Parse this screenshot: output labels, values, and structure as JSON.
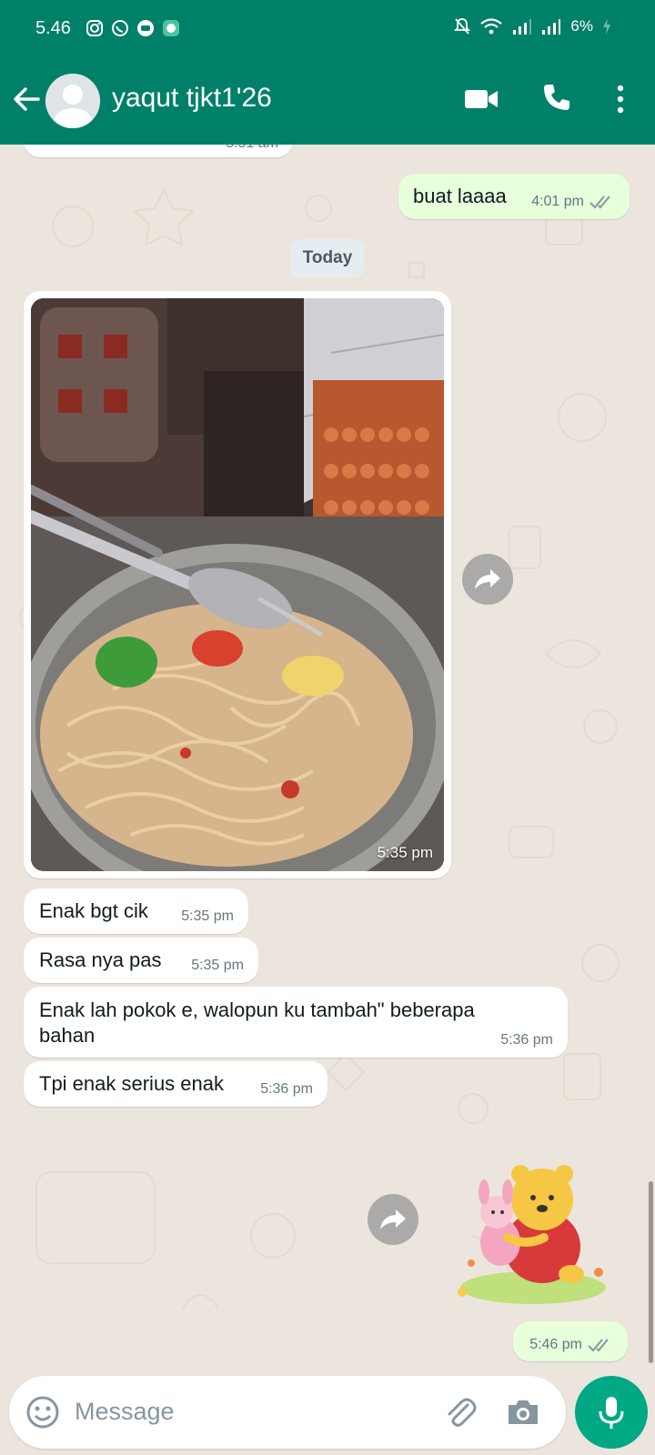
{
  "status_bar": {
    "time": "5.46",
    "battery": "6%"
  },
  "header": {
    "contact_name": "yaqut tjkt1'26"
  },
  "messages": [
    {
      "id": "m0",
      "direction": "incoming",
      "text": "",
      "time": "5.51 am"
    },
    {
      "id": "m1",
      "direction": "outgoing",
      "text": "buat laaaa",
      "time": "4:01 pm",
      "status": "read"
    },
    {
      "id": "m3",
      "direction": "incoming",
      "type": "photo",
      "time": "5:35 pm"
    },
    {
      "id": "m4",
      "direction": "incoming",
      "text": "Enak bgt cik",
      "time": "5:35 pm"
    },
    {
      "id": "m5",
      "direction": "incoming",
      "text": "Rasa nya pas",
      "time": "5:35 pm"
    },
    {
      "id": "m6",
      "direction": "incoming",
      "text": "Enak lah pokok e, walopun ku tambah\" beberapa bahan",
      "time": "5:36 pm"
    },
    {
      "id": "m7",
      "direction": "incoming",
      "text": "Tpi enak serius enak",
      "time": "5:36 pm"
    },
    {
      "id": "m8",
      "direction": "outgoing",
      "type": "sticker",
      "time": "5:46 pm",
      "status": "read"
    }
  ],
  "date_divider": "Today",
  "composer": {
    "placeholder": "Message"
  },
  "colors": {
    "header": "#008069",
    "incoming_bubble": "#ffffff",
    "outgoing_bubble": "#e7ffdb",
    "read_ticks": "#8696a0",
    "mic_button": "#00a884",
    "wallpaper": "#ece5dd"
  },
  "icons": [
    "back-arrow-icon",
    "video-call-icon",
    "voice-call-icon",
    "more-vert-icon",
    "forward-icon",
    "emoji-icon",
    "attach-icon",
    "camera-icon",
    "mic-icon",
    "double-check-icon"
  ]
}
